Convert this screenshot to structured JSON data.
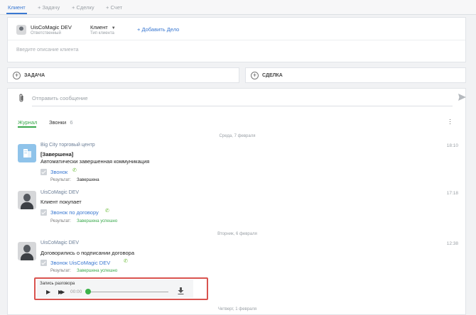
{
  "tabs": [
    {
      "label": "Клиент"
    },
    {
      "label": "+ Задачу"
    },
    {
      "label": "+ Сделку"
    },
    {
      "label": "+ Счет"
    }
  ],
  "client": {
    "name": "UisCoMagic DEV",
    "role": "Ответственный",
    "type_value": "Клиент",
    "type_label": "Тип клиента",
    "add_deal": "+ Добавить Дело",
    "description_placeholder": "Введите описание клиента"
  },
  "actions": {
    "task": "ЗАДАЧА",
    "deal": "СДЕЛКА"
  },
  "composer": {
    "placeholder": "Отправить сообщение"
  },
  "feed_tabs": {
    "journal": "Журнал",
    "calls_label": "Звонки",
    "calls_count": "6"
  },
  "dates": {
    "wed": "Среда, 7 февраля",
    "tue": "Вторник, 6 февраля",
    "thu": "Четверг, 1 февраля"
  },
  "messages": [
    {
      "name": "Big City торговый центр",
      "time": "18:10",
      "status": "[Завершена]",
      "text": "Автоматически завершенная коммуникация",
      "call_link": "Звонок",
      "result_label": "Результат:",
      "result_value": "Завершена"
    },
    {
      "name": "UisCoMagic DEV",
      "time": "17:18",
      "text": "Клиент покупает",
      "call_link": "Звонок по договору",
      "result_label": "Результат:",
      "result_value": "Завершена успешно"
    },
    {
      "name": "UisCoMagic DEV",
      "time": "12:38",
      "text": "Договорились о подписании договора",
      "call_link": "Звонок UisCoMagic DEV",
      "result_label": "Результат:",
      "result_value": "Завершена успешно"
    }
  ],
  "recording": {
    "title": "Запись разговора",
    "time": "00:00",
    "progress": 0
  },
  "colors": {
    "accent": "#3a78d1",
    "success": "#37a84a",
    "highlight_border": "#d9534f"
  }
}
